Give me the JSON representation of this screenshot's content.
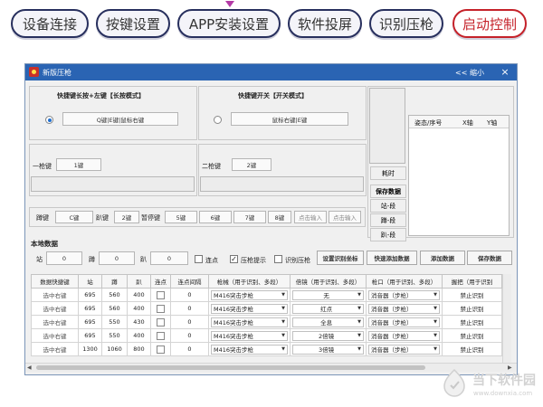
{
  "nav": {
    "tabs": [
      {
        "label": "设备连接",
        "active": false
      },
      {
        "label": "按键设置",
        "active": false
      },
      {
        "label": "APP安装设置",
        "active": false
      },
      {
        "label": "软件投屏",
        "active": false
      },
      {
        "label": "识别压枪",
        "active": false
      },
      {
        "label": "启动控制",
        "active": true
      }
    ]
  },
  "window": {
    "title": "新版压枪",
    "minimize_label": "<< 缩小",
    "close_label": "×"
  },
  "mode": {
    "long_press_title": "快捷键长按+左键【长按模式】",
    "long_press_key": "Q键|E键|鼠标右键",
    "long_press_selected": true,
    "toggle_title": "快捷键开关【开关模式】",
    "toggle_key": "鼠标右键|E键",
    "toggle_selected": false
  },
  "guns": {
    "gun1_label": "一枪键",
    "gun1_value": "1键",
    "gun2_label": "二枪键",
    "gun2_value": "2键"
  },
  "keys": {
    "crouch_label": "蹲键",
    "crouch_value": "C键",
    "prone_label": "趴键",
    "prone_value": "2键",
    "pause_label": "暂停键",
    "pause_values": [
      "5键",
      "6键",
      "7键",
      "8键"
    ],
    "input_buttons": [
      "点击输入",
      "点击输入"
    ]
  },
  "side": {
    "elapsed_label": "耗时",
    "save_label": "保存数据",
    "items": [
      "站-段",
      "蹲-段",
      "趴-段"
    ],
    "table_headers": [
      "姿态/序号",
      "X轴",
      "Y轴"
    ]
  },
  "local": {
    "section_title": "本地数据",
    "stand_label": "站",
    "stand_value": "0",
    "crouch_label": "蹲",
    "crouch_value": "0",
    "prone_label": "趴",
    "prone_value": "0",
    "burst_label": "连点",
    "burst_checked": false,
    "hint_label": "压枪提示",
    "hint_checked": true,
    "recog_label": "识别压枪",
    "recog_checked": false,
    "btn_coord": "设置识别坐标",
    "btn_quick_add": "快速添加数据",
    "btn_add": "添加数据",
    "btn_save": "保存数据"
  },
  "table": {
    "headers": [
      "数据快捷键",
      "站",
      "蹲",
      "趴",
      "连点",
      "连点间隔",
      "枪械（用于识别、多段）",
      "倍镜（用于识别、多段）",
      "枪口（用于识别、多段）",
      "握把（用于识别"
    ],
    "rows": [
      {
        "hotkey": "选中右键",
        "stand": "695",
        "crouch": "560",
        "prone": "400",
        "interval": "0",
        "weapon": "M416突击步枪",
        "scope": "无",
        "muzzle": "消音器（步枪）",
        "grip": "禁止识别"
      },
      {
        "hotkey": "选中右键",
        "stand": "695",
        "crouch": "560",
        "prone": "400",
        "interval": "0",
        "weapon": "M416突击步枪",
        "scope": "红点",
        "muzzle": "消音器（步枪）",
        "grip": "禁止识别"
      },
      {
        "hotkey": "选中右键",
        "stand": "695",
        "crouch": "550",
        "prone": "430",
        "interval": "0",
        "weapon": "M416突击步枪",
        "scope": "全息",
        "muzzle": "消音器（步枪）",
        "grip": "禁止识别"
      },
      {
        "hotkey": "选中右键",
        "stand": "695",
        "crouch": "550",
        "prone": "400",
        "interval": "0",
        "weapon": "M416突击步枪",
        "scope": "2倍镜",
        "muzzle": "消音器（步枪）",
        "grip": "禁止识别"
      },
      {
        "hotkey": "选中右键",
        "stand": "1300",
        "crouch": "1060",
        "prone": "800",
        "interval": "0",
        "weapon": "M416突击步枪",
        "scope": "3倍镜",
        "muzzle": "消音器（步枪）",
        "grip": "禁止识别"
      }
    ]
  },
  "watermark": {
    "brand": "当下软件园",
    "url": "www.downxia.com"
  },
  "colors": {
    "title_bar": "#2a64b3",
    "tab_border": "#28305e",
    "active_tab": "#c5222a",
    "accent_radio": "#1f6fd0"
  }
}
